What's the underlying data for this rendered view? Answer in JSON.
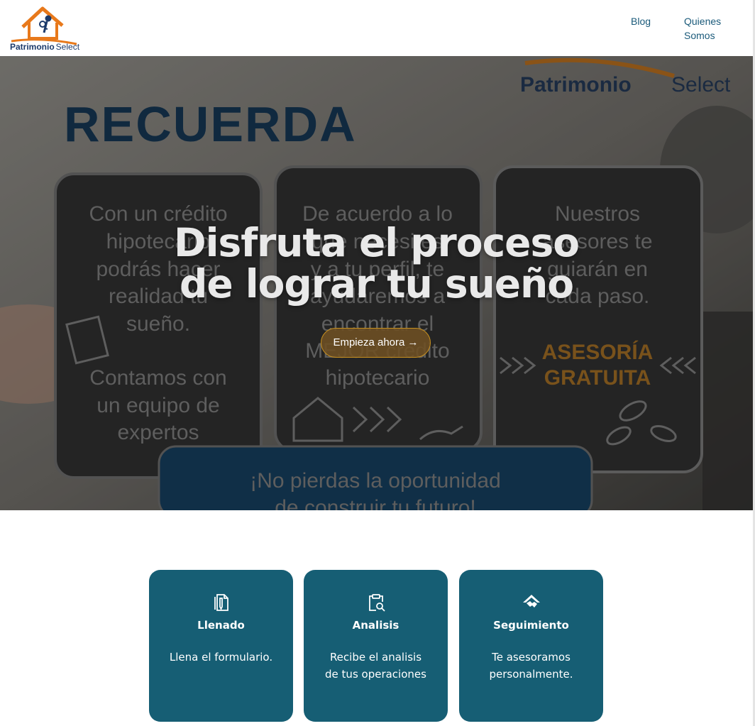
{
  "header": {
    "logo_name": "Patrimonio",
    "logo_sub": "Select",
    "nav": [
      {
        "label": "Blog"
      },
      {
        "label": "Quienes Somos"
      }
    ]
  },
  "hero": {
    "image_text": {
      "brand": "Patrimonio",
      "brand_sub": "Select",
      "recuerda": "RECUERDA",
      "panel_1": [
        "Con un crédito",
        "hipotecario",
        "podrás hacer",
        "realidad tu",
        "sueño.",
        "Contamos con",
        "un equipo de",
        "expertos"
      ],
      "panel_2": [
        "De acuerdo a lo",
        "que necesites",
        "y a tu perfil, te",
        "ayudaremos a",
        "encontrar el",
        "MEJOR crédito",
        "hipotecario"
      ],
      "panel_3": [
        "Nuestros",
        "asesores te",
        "guiarán en",
        "cada paso."
      ],
      "asesoria": [
        "ASESORÍA",
        "GRATUITA"
      ],
      "banner": [
        "¡No pierdas la oportunidad",
        "de construir tu futuro!"
      ]
    },
    "title_line1": "Disfruta el proceso",
    "title_line2": "de lograr tu sueño",
    "cta": "Empieza ahora →"
  },
  "cards": [
    {
      "icon": "document-icon",
      "title": "Llenado",
      "desc": "Llena el formulario."
    },
    {
      "icon": "clipboard-search-icon",
      "title": "Analisis",
      "desc": "Recibe el analisis de tus operaciones"
    },
    {
      "icon": "house-handshake-icon",
      "title": "Seguimiento",
      "desc": "Te asesoramos personalmente."
    }
  ],
  "colors": {
    "brand_orange": "#e8791b",
    "brand_navy": "#1b3a6b",
    "card_teal": "#165e74",
    "cta_gold": "#c7901f"
  }
}
